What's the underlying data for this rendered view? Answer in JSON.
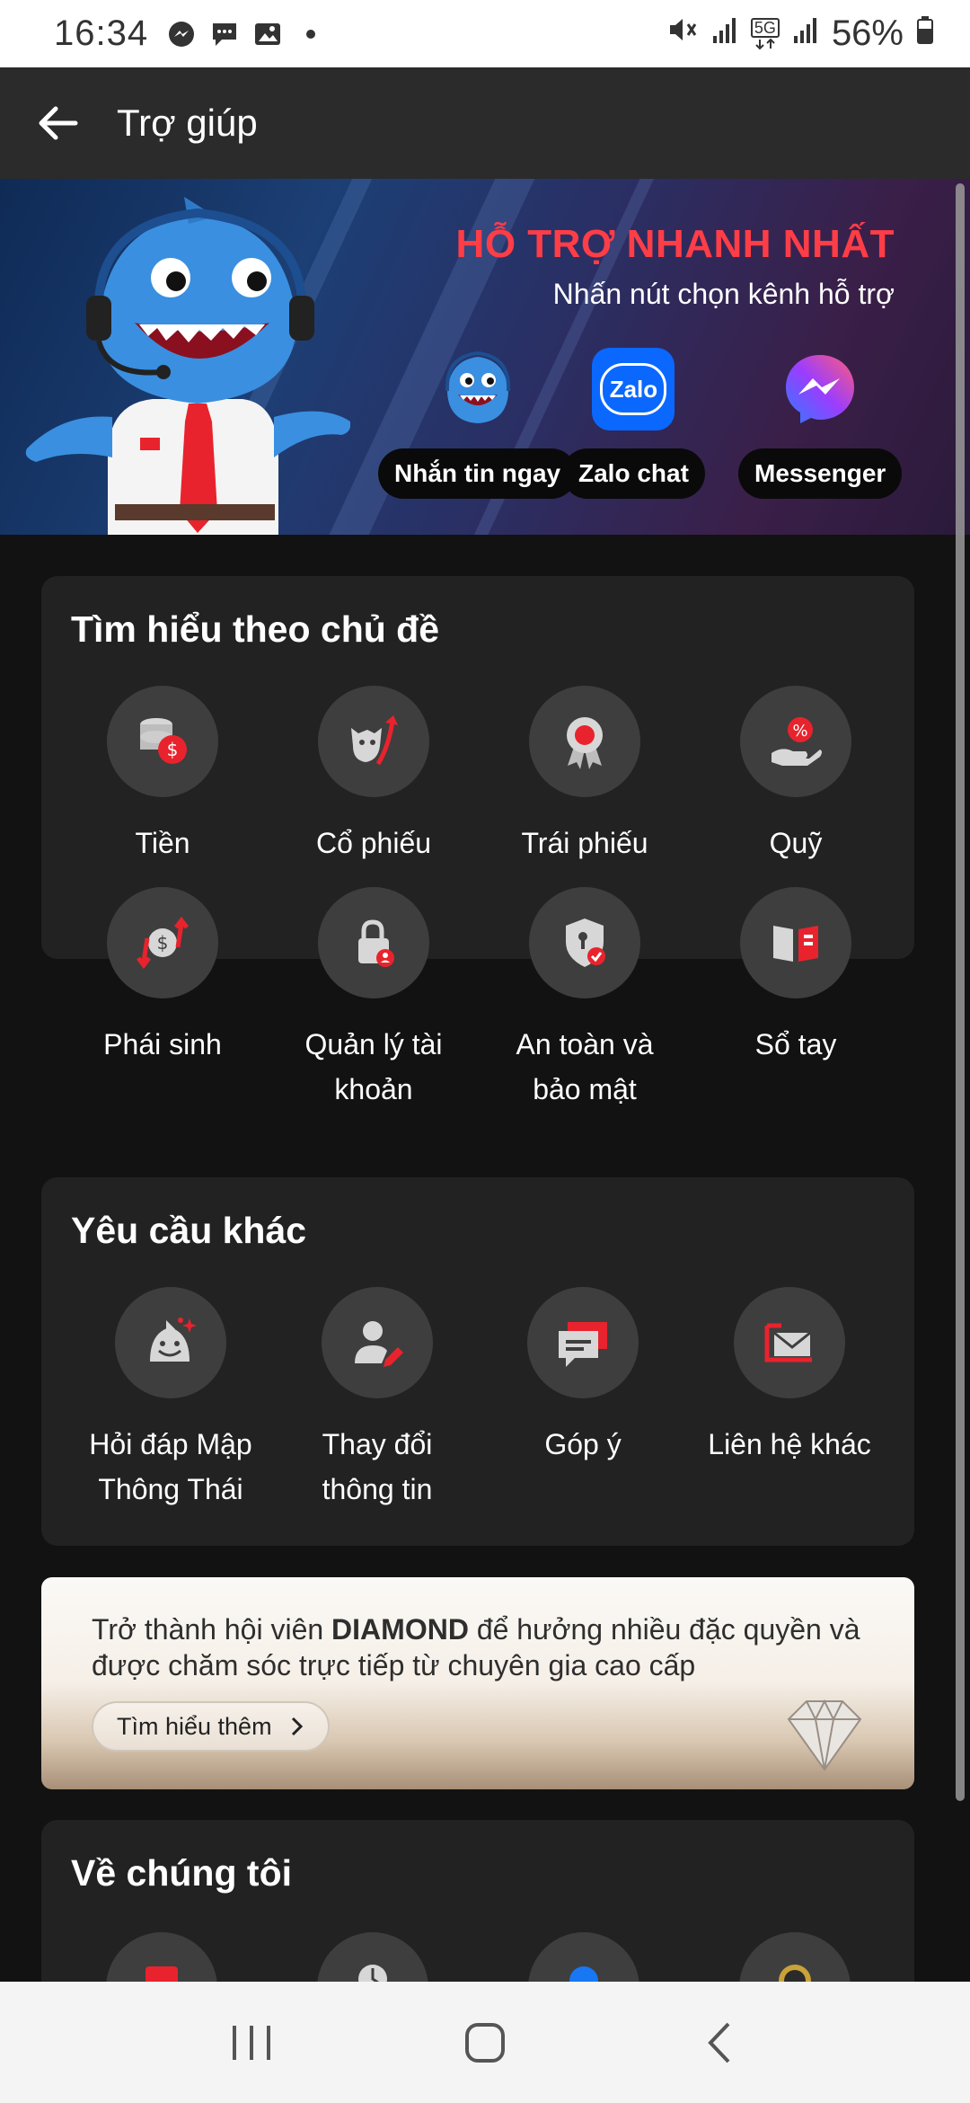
{
  "status": {
    "time": "16:34",
    "battery": "56%",
    "network": "5G"
  },
  "app_bar": {
    "title": "Trợ giúp"
  },
  "banner": {
    "title": "HỖ TRỢ NHANH NHẤT",
    "subtitle": "Nhấn nút chọn kênh hỗ trợ",
    "channels": [
      {
        "label": "Nhắn tin ngay",
        "icon": "shark-mascot-icon"
      },
      {
        "label": "Zalo chat",
        "icon": "zalo-icon",
        "icon_text": "Zalo"
      },
      {
        "label": "Messenger",
        "icon": "messenger-icon"
      }
    ]
  },
  "topics": {
    "title": "Tìm hiểu theo chủ đề",
    "items": [
      {
        "label": "Tiền",
        "icon": "money-coins-icon"
      },
      {
        "label": "Cổ phiếu",
        "icon": "bull-stock-icon"
      },
      {
        "label": "Trái phiếu",
        "icon": "bond-medal-icon"
      },
      {
        "label": "Quỹ",
        "icon": "fund-hand-percent-icon"
      },
      {
        "label": "Phái sinh",
        "icon": "derivative-dollar-icon"
      },
      {
        "label": "Quản lý tài khoản",
        "icon": "account-lock-icon"
      },
      {
        "label": "An toàn và bảo mật",
        "icon": "security-shield-icon"
      },
      {
        "label": "Sổ tay",
        "icon": "handbook-icon"
      }
    ]
  },
  "other_requests": {
    "title": "Yêu cầu khác",
    "items": [
      {
        "label": "Hỏi đáp Mập Thông Thái",
        "icon": "shark-ai-icon"
      },
      {
        "label": "Thay đổi thông tin",
        "icon": "edit-user-icon"
      },
      {
        "label": "Góp ý",
        "icon": "feedback-chat-icon"
      },
      {
        "label": "Liên hệ khác",
        "icon": "mail-icon"
      }
    ]
  },
  "promo": {
    "text_prefix": "Trở thành hội viên ",
    "text_bold": "DIAMOND",
    "text_suffix": " để hưởng nhiều đặc quyền và được chăm sóc trực tiếp từ chuyên gia cao cấp",
    "button_label": "Tìm hiểu thêm"
  },
  "about": {
    "title": "Về chúng tôi"
  },
  "colors": {
    "accent": "#e8232d",
    "banner_title": "#ff3d47",
    "card_bg": "#222222",
    "icon_circle": "#3e3e3e"
  }
}
